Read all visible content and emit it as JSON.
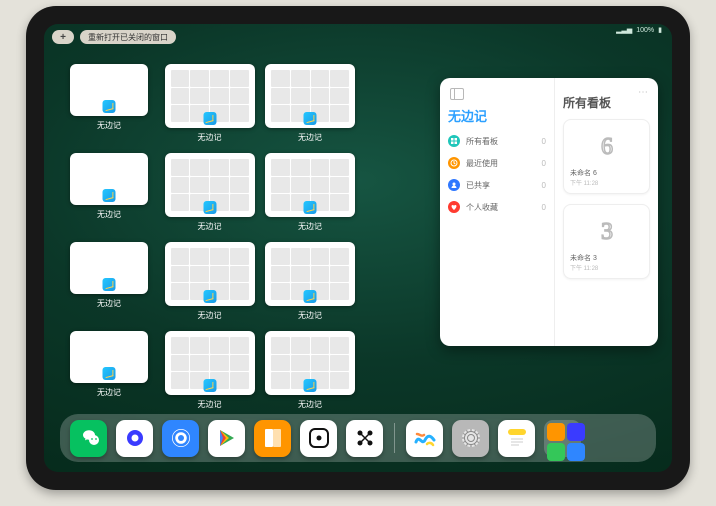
{
  "statusbar": {
    "signal": "▂▃▅",
    "battery": "100%",
    "wifi": "wifi"
  },
  "toolbar": {
    "add": "+",
    "reopen": "重新打开已关闭的窗口"
  },
  "windows": {
    "label": "无边记",
    "items": [
      {
        "style": "plain"
      },
      {
        "style": "cal"
      },
      {
        "style": "cal"
      },
      {
        "style": "plain"
      },
      {
        "style": "cal"
      },
      {
        "style": "cal"
      },
      {
        "style": "plain"
      },
      {
        "style": "cal"
      },
      {
        "style": "cal"
      },
      {
        "style": "plain"
      },
      {
        "style": "cal"
      },
      {
        "style": "cal"
      }
    ]
  },
  "panel": {
    "left_title": "无边记",
    "rows": [
      {
        "label": "所有看板",
        "count": "0",
        "color": "#20c6ba",
        "icon": "grid"
      },
      {
        "label": "最近使用",
        "count": "0",
        "color": "#ff9500",
        "icon": "clock"
      },
      {
        "label": "已共享",
        "count": "0",
        "color": "#2f78ff",
        "icon": "person"
      },
      {
        "label": "个人收藏",
        "count": "0",
        "color": "#ff3b30",
        "icon": "heart"
      }
    ],
    "right_title": "所有看板",
    "cards": [
      {
        "scribble": "6",
        "title": "未命名 6",
        "sub": "下午 11:28"
      },
      {
        "scribble": "3",
        "title": "未命名 3",
        "sub": "下午 11:28"
      }
    ],
    "more": "⋯"
  },
  "dock": {
    "items": [
      {
        "name": "wechat",
        "bg": "#06c160"
      },
      {
        "name": "quark",
        "bg": "#ffffff"
      },
      {
        "name": "qqbrowser",
        "bg": "#2f86ff"
      },
      {
        "name": "play",
        "bg": "#ffffff"
      },
      {
        "name": "books",
        "bg": "#ff9500"
      },
      {
        "name": "dice",
        "bg": "#ffffff"
      },
      {
        "name": "dots",
        "bg": "#ffffff"
      },
      {
        "name": "freeform",
        "bg": "#ffffff"
      },
      {
        "name": "settings",
        "bg": "#b8b8b8"
      },
      {
        "name": "notes",
        "bg": "#ffffff"
      }
    ],
    "recent_group": [
      "a",
      "b",
      "c",
      "d"
    ]
  }
}
